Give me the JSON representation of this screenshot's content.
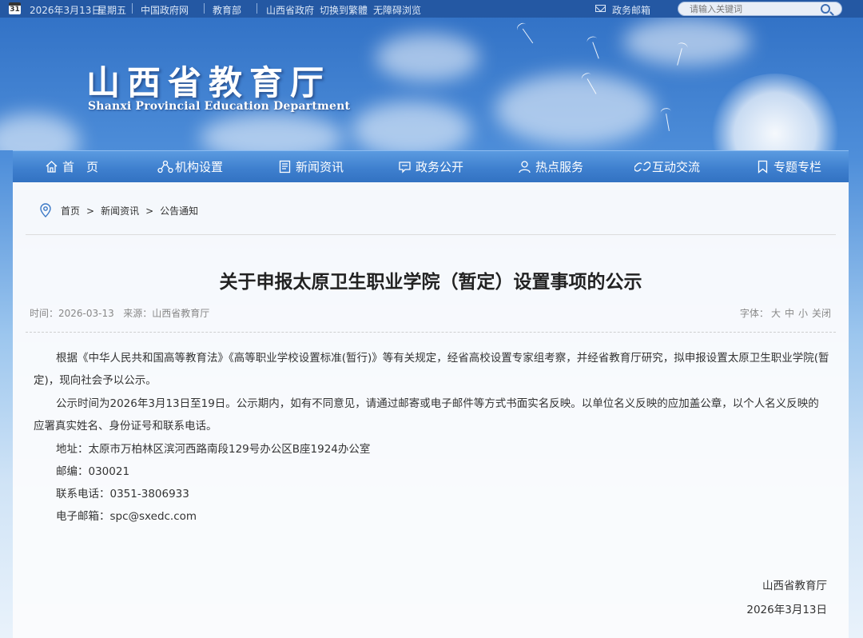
{
  "topbar": {
    "date": "2026年3月13日",
    "weekday": "星期五",
    "calendar_day": "31",
    "links": [
      "中国政府网",
      "教育部",
      "山西省政府"
    ],
    "switch_label": "切换到繁體",
    "accessibility_label": "无障碍浏览",
    "mail_label": "政务邮箱",
    "search_placeholder": "请输入关键词"
  },
  "banner": {
    "title": "山西省教育厅",
    "subtitle": "Shanxi Provincial Education Department"
  },
  "nav": {
    "items": [
      {
        "label": "首　页",
        "icon": "home-icon"
      },
      {
        "label": "机构设置",
        "icon": "org-icon"
      },
      {
        "label": "新闻资讯",
        "icon": "news-icon"
      },
      {
        "label": "政务公开",
        "icon": "gov-icon"
      },
      {
        "label": "热点服务",
        "icon": "service-icon"
      },
      {
        "label": "互动交流",
        "icon": "chat-icon"
      },
      {
        "label": "专题专栏",
        "icon": "bookmark-icon"
      }
    ]
  },
  "breadcrumb": [
    "首页",
    "新闻资讯",
    "公告通知"
  ],
  "article": {
    "title": "关于申报太原卫生职业学院（暂定）设置事项的公示",
    "time_label": "时间：",
    "time_value": "2026-03-13",
    "source_label": "来源：",
    "source_value": "山西省教育厅",
    "font_label": "字体：",
    "font_options": [
      "大",
      "中",
      "小",
      "关闭"
    ],
    "paragraphs": [
      "根据《中华人民共和国高等教育法》《高等职业学校设置标准(暂行)》等有关规定，经省高校设置专家组考察，并经省教育厅研究，拟申报设置太原卫生职业学院(暂定)，现向社会予以公示。",
      "公示时间为2026年3月13日至19日。公示期内，如有不同意见，请通过邮寄或电子邮件等方式书面实名反映。以单位名义反映的应加盖公章，以个人名义反映的应署真实姓名、身份证号和联系电话。"
    ],
    "contact_lines": [
      "地址：太原市万柏林区滨河西路南段129号办公区B座1924办公室",
      "邮编：030021",
      "联系电话：0351-3806933",
      "电子邮箱：spc@sxedc.com"
    ],
    "signature_org": "山西省教育厅",
    "signature_date": "2026年3月13日"
  },
  "colors": {
    "topbar_bg": "#2458a3",
    "nav_bg": "#3f80cf",
    "panel_bg": "#fafbfd"
  }
}
